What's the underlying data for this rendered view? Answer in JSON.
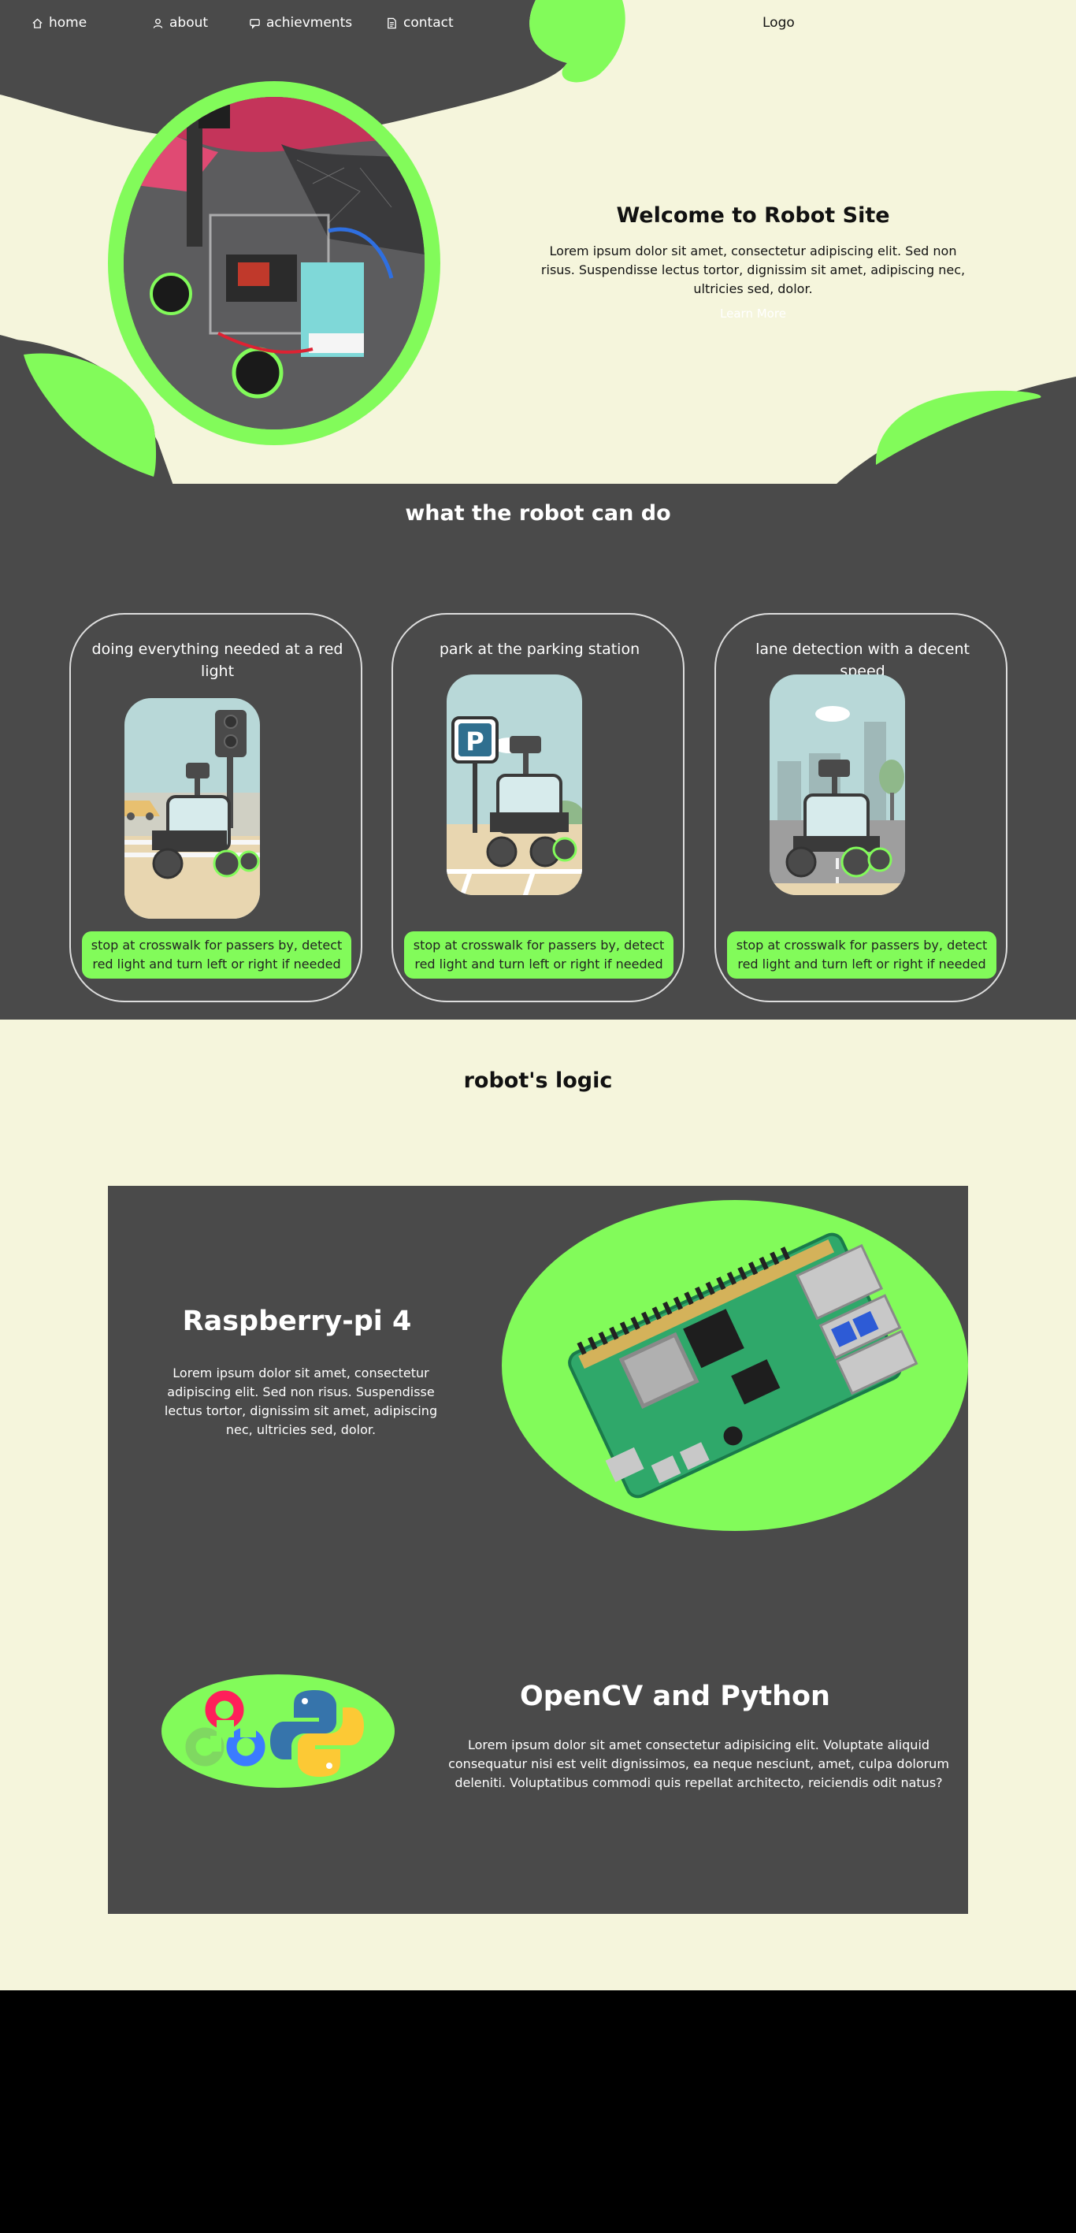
{
  "nav": {
    "items": [
      {
        "label": "home",
        "icon": "home-icon"
      },
      {
        "label": "about",
        "icon": "user-icon"
      },
      {
        "label": "achievments",
        "icon": "message-icon"
      },
      {
        "label": "contact",
        "icon": "document-icon"
      }
    ],
    "logo": "Logo"
  },
  "hero": {
    "title": "Welcome to Robot Site",
    "description": "Lorem ipsum dolor sit amet, consectetur adipiscing elit. Sed non risus. Suspendisse lectus tortor, dignissim sit amet, adipiscing nec, ultricies sed, dolor.",
    "button": "Learn More"
  },
  "features": {
    "title": "what the robot can do",
    "cards": [
      {
        "title": "doing everything needed at a red light",
        "caption": "stop at crosswalk for passers by, detect red light and turn left or right if needed"
      },
      {
        "title": "park at the parking station",
        "caption": "stop at crosswalk for passers by, detect red light and turn left or right if needed"
      },
      {
        "title": "lane detection with a decent speed",
        "caption": "stop at crosswalk for passers by, detect red light and turn left or right if needed"
      }
    ]
  },
  "logic": {
    "title": "robot's logic",
    "rpi": {
      "title": "Raspberry-pi 4",
      "description": "Lorem ipsum dolor sit amet, consectetur adipiscing elit. Sed non risus. Suspendisse lectus tortor, dignissim sit amet, adipiscing nec, ultricies sed, dolor."
    },
    "opencv": {
      "title": "OpenCV and Python",
      "description": "Lorem ipsum dolor sit amet consectetur adipisicing elit. Voluptate aliquid consequatur nisi est velit dignissimos, ea neque nesciunt, amet, culpa dolorum deleniti. Voluptatibus commodi quis repellat architecto, reiciendis odit natus?"
    }
  },
  "colors": {
    "accent": "#82fb5a",
    "dark": "#4a4a4a",
    "cream": "#f5f5dc",
    "footer": "#000000"
  }
}
